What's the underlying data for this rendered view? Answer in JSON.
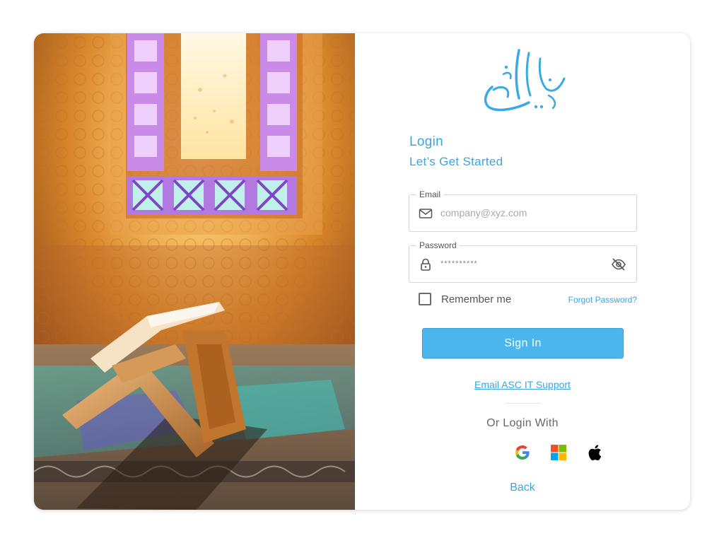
{
  "brand": {
    "accent": "#3aa5e0",
    "button": "#4bb6ee"
  },
  "form": {
    "title": "Login",
    "subtitle": "Let’s Get Started",
    "email": {
      "label": "Email",
      "placeholder": "company@xyz.com",
      "value": ""
    },
    "password": {
      "label": "Password",
      "masked_value": "**********"
    },
    "remember_label": "Remember me",
    "remember_checked": false,
    "forgot_label": "Forgot Password?",
    "signin_label": "Sign In",
    "support_label": "Email ASC IT Support",
    "or_label": "Or Login With",
    "social": [
      "google-icon",
      "microsoft-icon",
      "apple-icon"
    ],
    "back_label": "Back"
  },
  "icons": {
    "email": "mail-icon",
    "password": "lock-icon",
    "toggle": "eye-off-icon"
  }
}
